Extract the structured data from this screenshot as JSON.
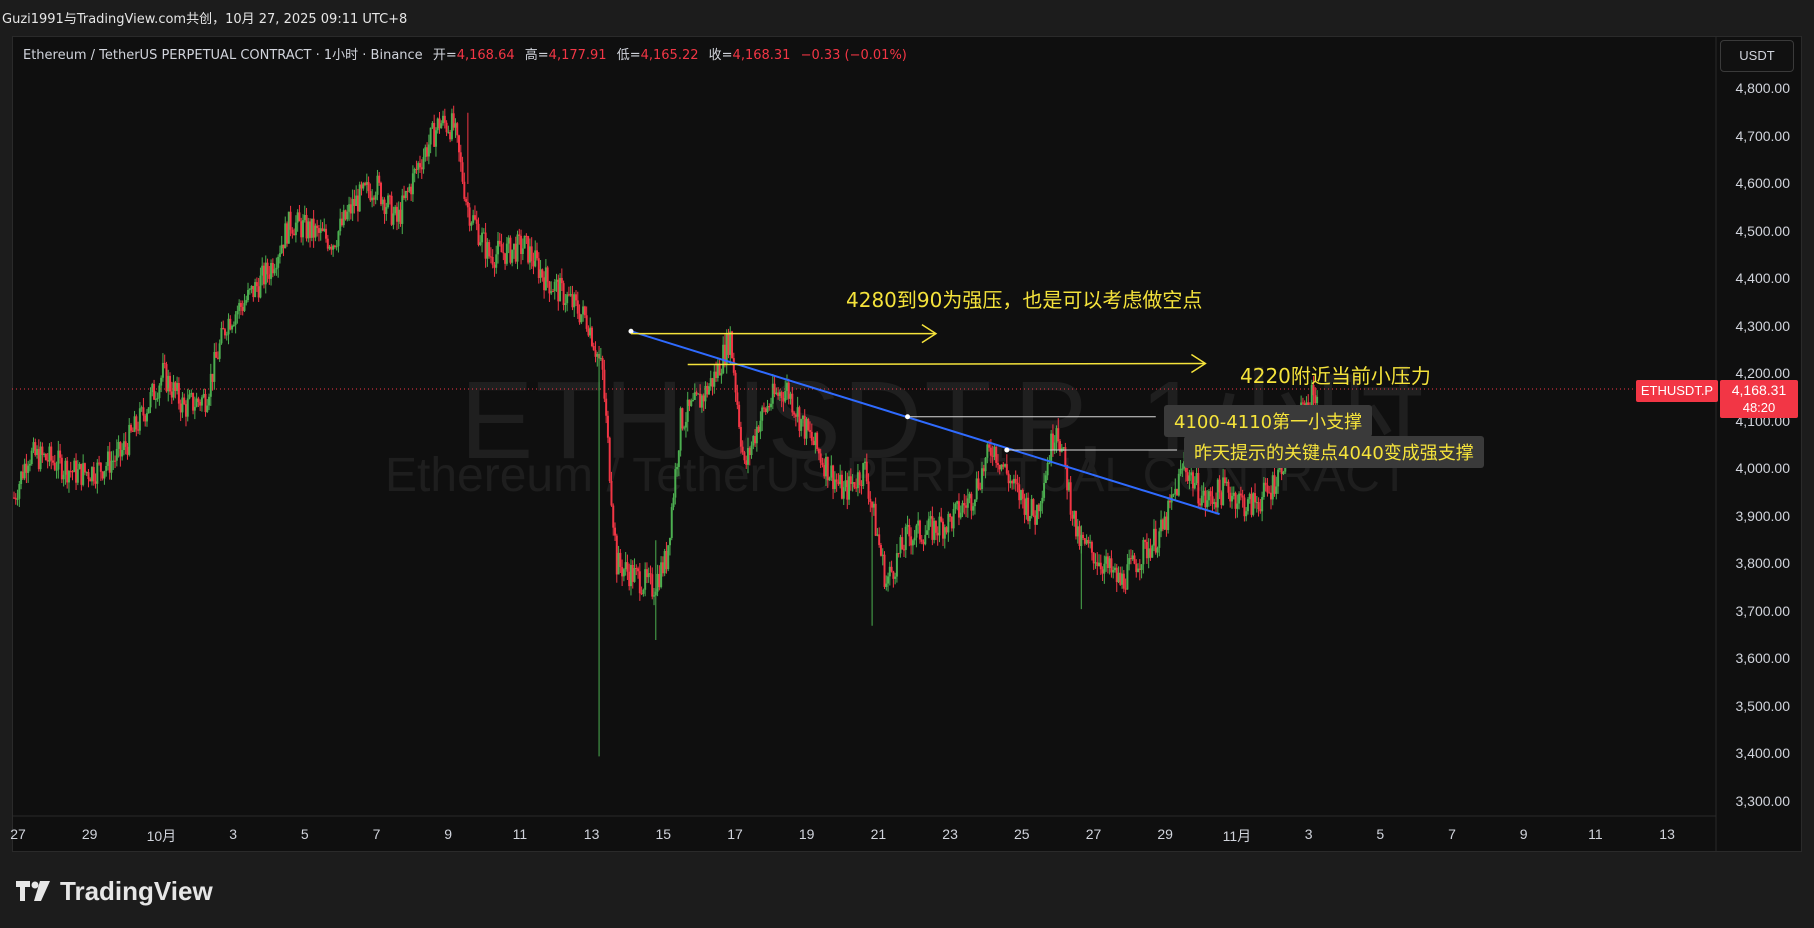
{
  "topbar": {
    "text": "Guzi1991与TradingView.com共创，10月 27, 2025 09:11 UTC+8"
  },
  "legend": {
    "symbol": "Ethereum / TetherUS PERPETUAL CONTRACT · 1小时 · Binance",
    "open_label": "开=",
    "open_value": "4,168.64",
    "high_label": "高=",
    "high_value": "4,177.91",
    "low_label": "低=",
    "low_value": "4,165.22",
    "close_label": "收=",
    "close_value": "4,168.31",
    "change": "−0.33 (−0.01%)"
  },
  "currency_button": "USDT",
  "watermark": {
    "main": "ETHUSDT.P, 1小时",
    "sub": "Ethereum / TetherUS PERPETUAL CONTRACT"
  },
  "price_axis": {
    "labels": [
      "4,800.00",
      "4,700.00",
      "4,600.00",
      "4,500.00",
      "4,400.00",
      "4,300.00",
      "4,200.00",
      "4,100.00",
      "4,000.00",
      "3,900.00",
      "3,800.00",
      "3,700.00",
      "3,600.00",
      "3,500.00",
      "3,400.00",
      "3,300.00"
    ]
  },
  "date_axis": {
    "labels": [
      "27",
      "29",
      "10月",
      "3",
      "5",
      "7",
      "9",
      "11",
      "13",
      "15",
      "17",
      "19",
      "21",
      "23",
      "25",
      "27",
      "29",
      "11月",
      "3",
      "5",
      "7",
      "9",
      "11",
      "13"
    ]
  },
  "last_price": {
    "symbol": "ETHUSDT.P",
    "price": "4,168.31",
    "countdown": "48:20"
  },
  "annotations": {
    "resistance_strong": "4280到90为强压，也是可以考虑做空点",
    "resistance_small": "4220附近当前小压力",
    "support_first": "4100-4110第一小支撑",
    "support_strong": "昨天提示的关键点4040变成强支撑"
  },
  "brand": {
    "name": "TradingView"
  },
  "colors": {
    "up": "#4caf50",
    "down": "#f23645",
    "trendline": "#2f6bff",
    "annotation": "#f5e33b",
    "background": "#0f0f0f"
  },
  "chart_data": {
    "type": "candlestick",
    "title": "Ethereum / TetherUS PERPETUAL CONTRACT · 1小时 · Binance",
    "ylim": [
      3250,
      4850
    ],
    "y_ticks": [
      4800,
      4700,
      4600,
      4500,
      4400,
      4300,
      4200,
      4100,
      4000,
      3900,
      3800,
      3700,
      3600,
      3500,
      3400,
      3300
    ],
    "x_ticks": [
      "27",
      "29",
      "10月",
      "3",
      "5",
      "7",
      "9",
      "11",
      "13",
      "15",
      "17",
      "19",
      "21",
      "23",
      "25",
      "27",
      "29",
      "11月",
      "3",
      "5",
      "7",
      "9",
      "11",
      "13"
    ],
    "ohlc_path": [
      [
        0,
        3940
      ],
      [
        2,
        4030
      ],
      [
        5,
        4020
      ],
      [
        9,
        3990
      ],
      [
        12,
        4000
      ],
      [
        15,
        4030
      ],
      [
        18,
        4110
      ],
      [
        21,
        4200
      ],
      [
        24,
        4130
      ],
      [
        27,
        4150
      ],
      [
        30,
        4310
      ],
      [
        33,
        4360
      ],
      [
        36,
        4420
      ],
      [
        39,
        4520
      ],
      [
        42,
        4500
      ],
      [
        45,
        4480
      ],
      [
        48,
        4560
      ],
      [
        51,
        4600
      ],
      [
        54,
        4520
      ],
      [
        57,
        4640
      ],
      [
        60,
        4730
      ],
      [
        62,
        4720
      ],
      [
        64,
        4550
      ],
      [
        67,
        4450
      ],
      [
        70,
        4460
      ],
      [
        72,
        4470
      ],
      [
        75,
        4400
      ],
      [
        78,
        4360
      ],
      [
        81,
        4310
      ],
      [
        83,
        4200
      ],
      [
        85,
        3800
      ],
      [
        87,
        3780
      ],
      [
        90,
        3750
      ],
      [
        92,
        3810
      ],
      [
        94,
        4100
      ],
      [
        97,
        4150
      ],
      [
        99,
        4200
      ],
      [
        101,
        4280
      ],
      [
        103,
        4000
      ],
      [
        105,
        4100
      ],
      [
        107,
        4150
      ],
      [
        109,
        4170
      ],
      [
        111,
        4100
      ],
      [
        114,
        4020
      ],
      [
        117,
        3950
      ],
      [
        120,
        4000
      ],
      [
        123,
        3760
      ],
      [
        126,
        3860
      ],
      [
        129,
        3870
      ],
      [
        132,
        3890
      ],
      [
        135,
        3940
      ],
      [
        138,
        4050
      ],
      [
        141,
        3960
      ],
      [
        144,
        3900
      ],
      [
        147,
        4100
      ],
      [
        150,
        3850
      ],
      [
        153,
        3810
      ],
      [
        156,
        3760
      ],
      [
        159,
        3820
      ],
      [
        162,
        3870
      ],
      [
        165,
        4010
      ],
      [
        168,
        3930
      ],
      [
        171,
        3960
      ],
      [
        174,
        3920
      ],
      [
        177,
        3950
      ],
      [
        180,
        4060
      ],
      [
        182,
        4130
      ],
      [
        184,
        4170
      ]
    ],
    "x_range": [
      0,
      240
    ],
    "last_close": 4168.31,
    "lines": [
      {
        "kind": "trendline",
        "from": [
          87,
          4290
        ],
        "to": [
          170,
          3905
        ]
      },
      {
        "kind": "horizontal",
        "from": [
          87,
          4285
        ],
        "to": [
          130,
          4285
        ],
        "label": "4280到90为强压，也是可以考虑做空点"
      },
      {
        "kind": "horizontal",
        "from": [
          95,
          4220
        ],
        "to": [
          168,
          4222
        ],
        "label": "4220附近当前小压力"
      },
      {
        "kind": "horizontal",
        "from": [
          126,
          4110
        ],
        "to": [
          161,
          4110
        ],
        "label": "4100-4110第一小支撑"
      },
      {
        "kind": "horizontal",
        "from": [
          140,
          4040
        ],
        "to": [
          164,
          4040
        ],
        "label": "昨天提示的关键点4040变成强支撑"
      }
    ]
  }
}
